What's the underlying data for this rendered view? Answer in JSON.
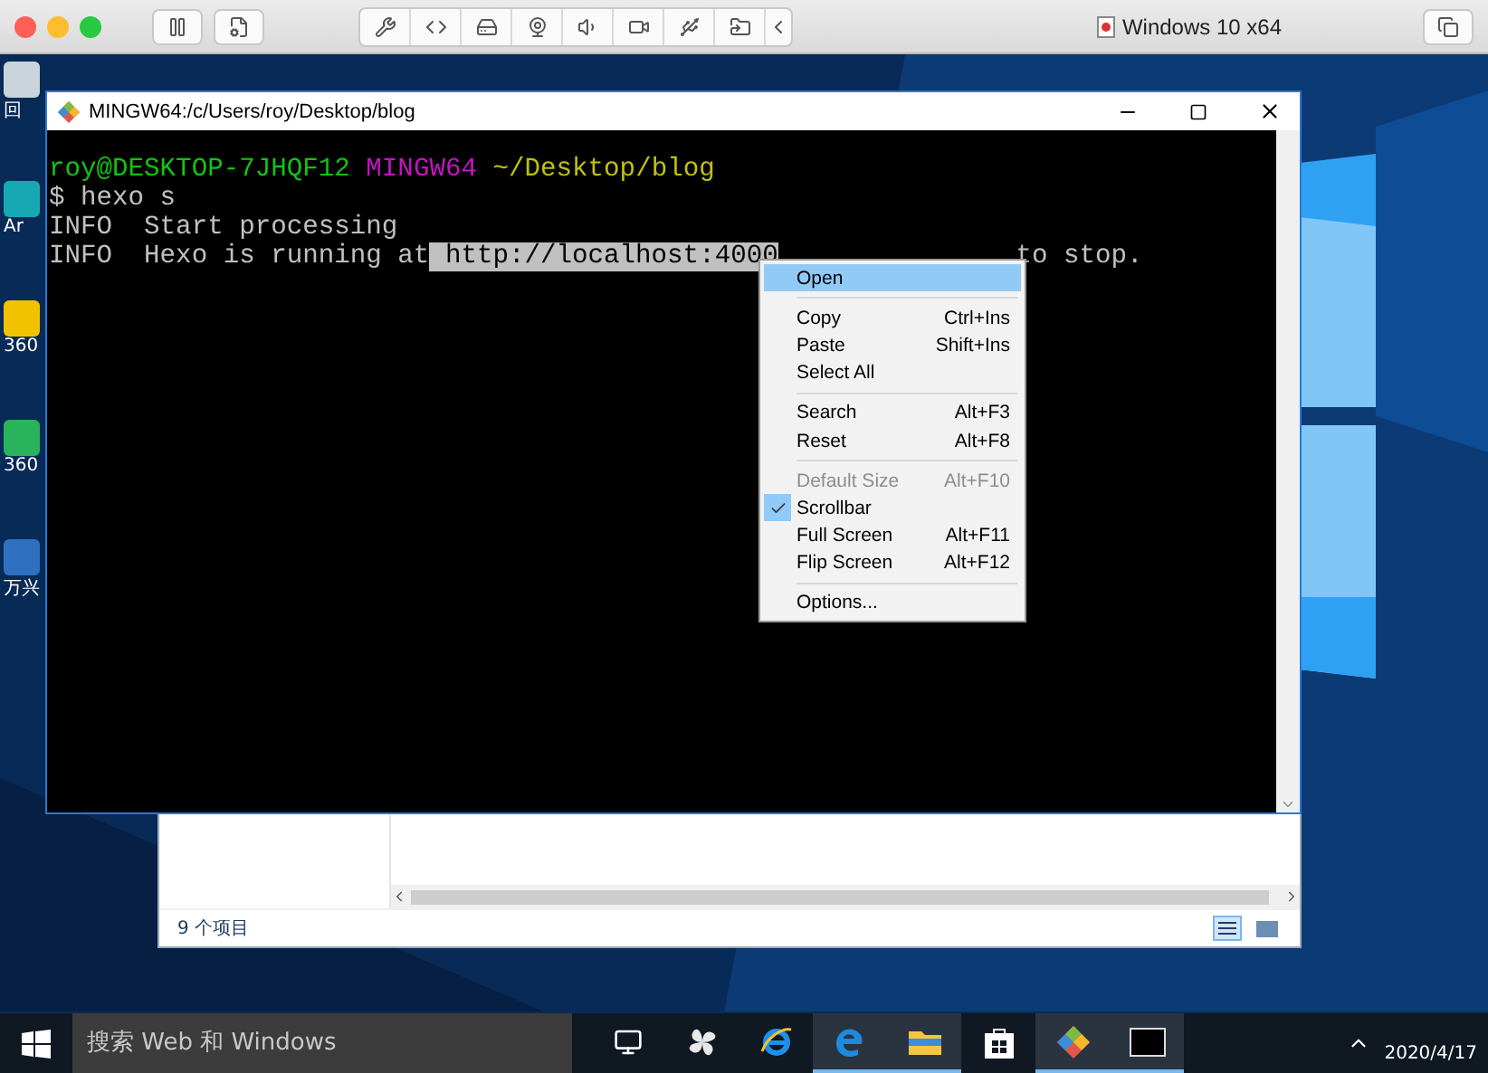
{
  "host_window": {
    "title": "Windows 10 x64"
  },
  "desktop_icons": [
    {
      "label": "回"
    },
    {
      "label": "Ar"
    },
    {
      "label": "360"
    },
    {
      "label": "360"
    },
    {
      "label": "万兴"
    }
  ],
  "terminal": {
    "title": "MINGW64:/c/Users/roy/Desktop/blog",
    "prompt": {
      "user_host": "roy@DESKTOP-7JHQF12",
      "shell": "MINGW64",
      "path": "~/Desktop/blog"
    },
    "lines": [
      {
        "text": "$ hexo s"
      },
      {
        "text": "INFO  Start processing"
      },
      {
        "text": "INFO  Hexo is running at",
        "selection": " http://localhost:4000",
        "tail": "to stop."
      }
    ]
  },
  "context_menu": [
    {
      "kind": "item",
      "label": "Open",
      "selected": true,
      "disabled": false,
      "checked": false
    },
    {
      "kind": "separator"
    },
    {
      "kind": "item",
      "label": "Copy",
      "shortcut": "Ctrl+Ins",
      "selected": false,
      "disabled": false,
      "checked": false
    },
    {
      "kind": "item",
      "label": "Paste",
      "shortcut": "Shift+Ins",
      "selected": false,
      "disabled": false,
      "checked": false
    },
    {
      "kind": "item",
      "label": "Select All",
      "selected": false,
      "disabled": false,
      "checked": false
    },
    {
      "kind": "separator"
    },
    {
      "kind": "item",
      "label": "Search",
      "shortcut": "Alt+F3",
      "selected": false,
      "disabled": false,
      "checked": false
    },
    {
      "kind": "item",
      "label": "Reset",
      "shortcut": "Alt+F8",
      "selected": false,
      "disabled": false,
      "checked": false
    },
    {
      "kind": "separator"
    },
    {
      "kind": "item",
      "label": "Default Size",
      "shortcut": "Alt+F10",
      "selected": false,
      "disabled": true,
      "checked": false
    },
    {
      "kind": "item",
      "label": "Scrollbar",
      "selected": false,
      "disabled": false,
      "checked": true
    },
    {
      "kind": "item",
      "label": "Full Screen",
      "shortcut": "Alt+F11",
      "selected": false,
      "disabled": false,
      "checked": false
    },
    {
      "kind": "item",
      "label": "Flip Screen",
      "shortcut": "Alt+F12",
      "selected": false,
      "disabled": false,
      "checked": false
    },
    {
      "kind": "separator"
    },
    {
      "kind": "item",
      "label": "Options...",
      "selected": false,
      "disabled": false,
      "checked": false
    }
  ],
  "explorer": {
    "status": "9 个项目"
  },
  "taskbar": {
    "search": {
      "placeholder": "搜索 Web 和 Windows"
    },
    "apps": [
      {
        "kind": "taskview",
        "active": false
      },
      {
        "kind": "fan",
        "active": false
      },
      {
        "kind": "ie",
        "active": false
      },
      {
        "kind": "edge",
        "active": true
      },
      {
        "kind": "folder",
        "active": true
      },
      {
        "kind": "store",
        "active": false
      },
      {
        "kind": "git",
        "active": true
      },
      {
        "kind": "terminal",
        "active": true
      }
    ],
    "date": "2020/4/17"
  }
}
